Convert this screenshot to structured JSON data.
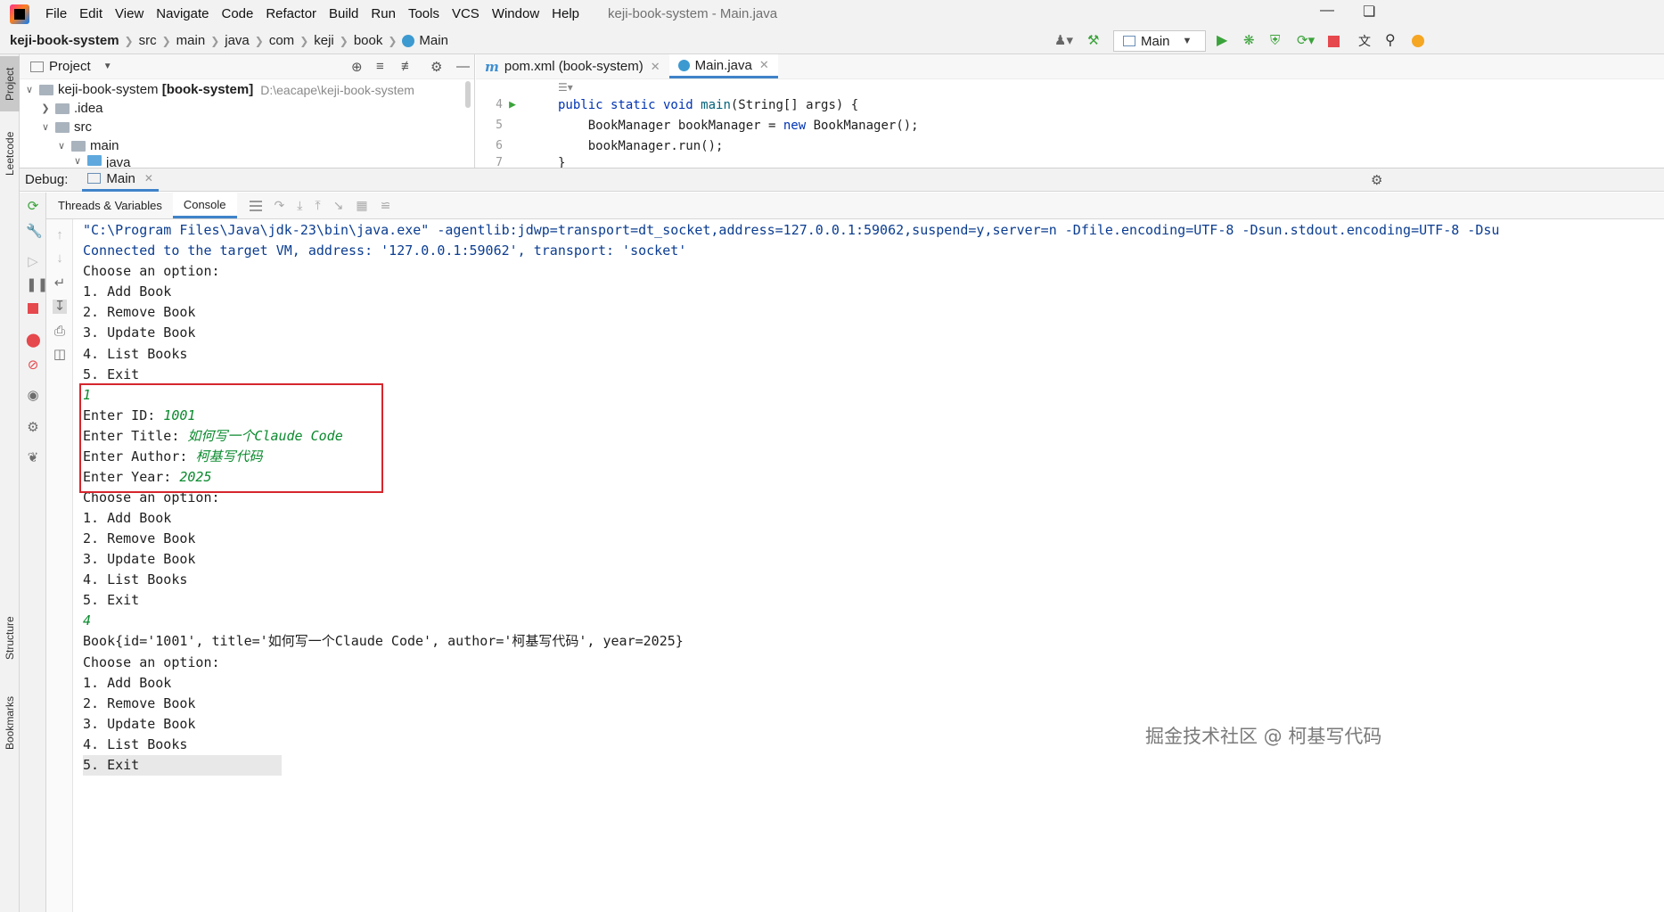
{
  "menubar": {
    "items": [
      "File",
      "Edit",
      "View",
      "Navigate",
      "Code",
      "Refactor",
      "Build",
      "Run",
      "Tools",
      "VCS",
      "Window",
      "Help"
    ],
    "window_title": "keji-book-system - Main.java"
  },
  "navbar": {
    "crumbs": [
      "keji-book-system",
      "src",
      "main",
      "java",
      "com",
      "keji",
      "book",
      "Main"
    ],
    "run_config": "Main"
  },
  "left_strip": {
    "tabs": [
      "Project",
      "Leetcode",
      "Structure",
      "Bookmarks"
    ]
  },
  "project": {
    "header": "Project",
    "tree": [
      {
        "name": "keji-book-system",
        "suffix": "[book-system]",
        "path": "D:\\eacape\\keji-book-system"
      },
      {
        "name": ".idea"
      },
      {
        "name": "src"
      },
      {
        "name": "main"
      },
      {
        "name": "java"
      }
    ]
  },
  "editor": {
    "tabs": [
      "pom.xml (book-system)",
      "Main.java"
    ],
    "lines": [
      {
        "num": "4",
        "code_kw1": "public static void ",
        "code_fn": "main",
        "code_rest": "(String[] args) {"
      },
      {
        "num": "5",
        "code_a": "    BookManager bookManager = ",
        "code_kw": "new",
        "code_b": " BookManager();"
      },
      {
        "num": "6",
        "code": "    bookManager.run();"
      },
      {
        "num": "7",
        "code": "}"
      }
    ]
  },
  "debug": {
    "label": "Debug:",
    "session": "Main",
    "subtabs": [
      "Threads & Variables",
      "Console"
    ]
  },
  "console": {
    "cmd": "\"C:\\Program Files\\Java\\jdk-23\\bin\\java.exe\" -agentlib:jdwp=transport=dt_socket,address=127.0.0.1:59062,suspend=y,server=n -Dfile.encoding=UTF-8 -Dsun.stdout.encoding=UTF-8 -Dsu",
    "connected": "Connected to the target VM, address: '127.0.0.1:59062', transport: 'socket'",
    "choose": "Choose an option:",
    "opt1": "1. Add Book",
    "opt2": "2. Remove Book",
    "opt3": "3. Update Book",
    "opt4": "4. List Books",
    "opt5": "5. Exit",
    "input1": "1",
    "enter_id": "Enter ID: ",
    "id_val": "1001",
    "enter_title": "Enter Title: ",
    "title_val": "如何写一个Claude Code",
    "enter_author": "Enter Author: ",
    "author_val": "柯基写代码",
    "enter_year": "Enter Year: ",
    "year_val": "2025",
    "input4": "4",
    "book_line": "Book{id='1001', title='如何写一个Claude Code', author='柯基写代码', year=2025}"
  },
  "watermark": "掘金技术社区 @ 柯基写代码",
  "colors": {
    "accent": "#4083c9",
    "user_input": "#0b8a2e",
    "highlight_box": "#d6262d",
    "run_green": "#3ba33b",
    "stop_red": "#e5484d"
  }
}
